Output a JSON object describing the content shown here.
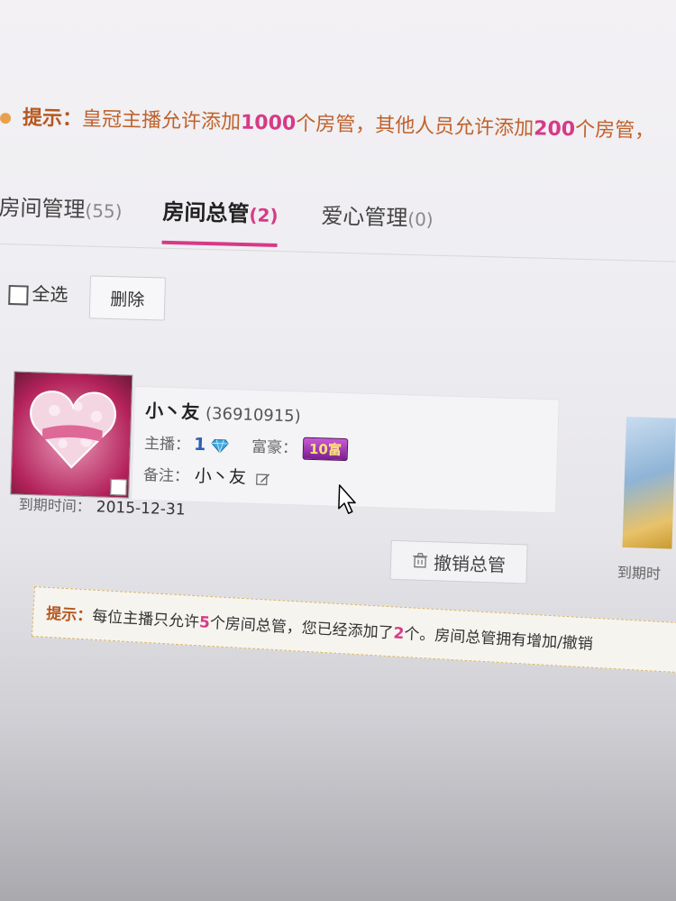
{
  "top_tip": {
    "label": "提示：",
    "text_1": "皇冠主播允许添加",
    "num_1": "1000",
    "text_2": "个房管，其他人员允许添加",
    "num_2": "200",
    "text_3": "个房管，"
  },
  "tabs": [
    {
      "label": "房间管理",
      "count": "(55)"
    },
    {
      "label": "房间总管",
      "count": "(2)"
    },
    {
      "label": "爱心管理",
      "count": "(0)"
    }
  ],
  "toolbar": {
    "select_all_label": "全选",
    "delete_label": "删除"
  },
  "card": {
    "name": "小丶友",
    "uid": "(36910915)",
    "anchor_label": "主播：",
    "anchor_level": "1",
    "rich_label": "富豪：",
    "rich_badge": "10富",
    "remark_label": "备注：",
    "remark_value": "小丶友",
    "expiry_label": "到期时间：",
    "expiry_value": "2015-12-31",
    "revoke_label": "撤销总管"
  },
  "right_card": {
    "expiry_label": "到期时"
  },
  "bottom_tip": {
    "label": "提示：",
    "text_1": "每位主播只允许",
    "num_1": "5",
    "text_2": "个房间总管，您已经添加了",
    "num_2": "2",
    "text_3": "个。房间总管拥有增加/撤销"
  },
  "colors": {
    "accent": "#d63a86",
    "tip_label": "#b5571f",
    "tip_text": "#c0622c",
    "rich_badge": "#7a1e8f"
  }
}
